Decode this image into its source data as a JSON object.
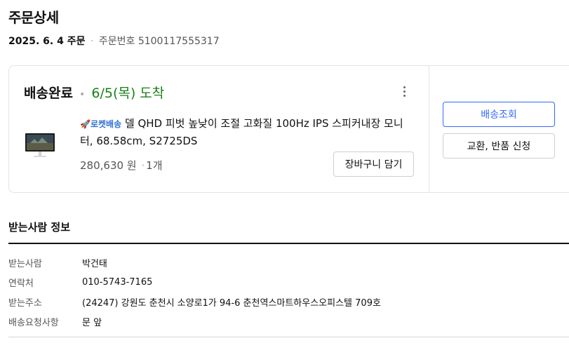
{
  "page": {
    "title": "주문상세"
  },
  "order": {
    "date": "2025. 6. 4 주문",
    "number_label": "주문번호",
    "number": "5100117555317"
  },
  "shipment": {
    "status": "배송완료",
    "arrival": "6/5(목) 도착",
    "product": {
      "badge": "로켓배송",
      "name": "델 QHD 피벗 높낮이 조절 고화질 100Hz IPS 스피커내장 모니터, 68.58cm, S2725DS",
      "price": "280,630 원",
      "quantity": "1개"
    },
    "cart_button": "장바구니 담기",
    "track_button": "배송조회",
    "return_button": "교환, 반품 신청"
  },
  "recipient": {
    "section_title": "받는사람 정보",
    "rows": [
      {
        "label": "받는사람",
        "value": "박건태"
      },
      {
        "label": "연락처",
        "value": "010-5743-7165"
      },
      {
        "label": "받는주소",
        "value": "(24247) 강원도 춘천시 소양로1가 94-6 춘천역스마트하우스오피스텔 709호"
      },
      {
        "label": "배송요청사항",
        "value": "문 앞"
      }
    ]
  },
  "colors": {
    "accent": "#346aff",
    "arrival": "#1a7f1a",
    "rocket": "#2f6fd6"
  },
  "icons": {
    "more": "more-vertical-icon",
    "rocket": "rocket-icon"
  }
}
